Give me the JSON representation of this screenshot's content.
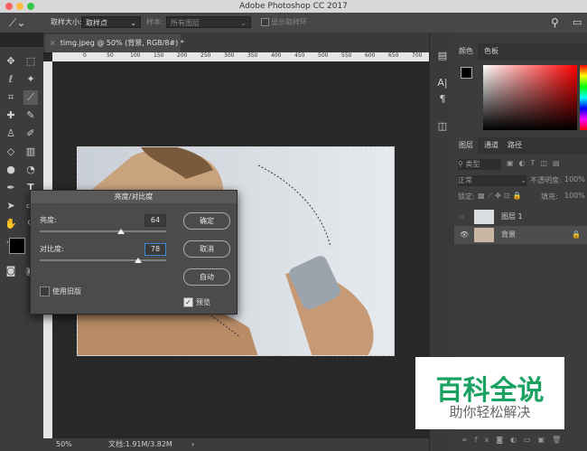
{
  "app": {
    "title": "Adobe Photoshop CC 2017"
  },
  "options": {
    "sample_size_label": "取样大小:",
    "sample_size_value": "取样点",
    "sample_label": "样本:",
    "sample_value": "所有图层",
    "show_ring_label": "显示取样环"
  },
  "document": {
    "tab_title": "timg.jpeg @ 50% (背景, RGB/8#) *",
    "zoom": "50%",
    "doc_info": "文档:1.91M/3.82M"
  },
  "ruler": {
    "ticks": [
      "0",
      "50",
      "100",
      "150",
      "200",
      "250",
      "300",
      "350",
      "400",
      "450",
      "500",
      "550",
      "600",
      "650",
      "700"
    ]
  },
  "panels": {
    "color_tab": "颜色",
    "swatches_tab": "色板",
    "layers_tab": "图层",
    "channels_tab": "通道",
    "paths_tab": "路径",
    "kind_filter": "类型",
    "blend_mode": "正常",
    "opacity_label": "不透明度:",
    "opacity_value": "100%",
    "lock_label": "锁定:",
    "fill_label": "填充:",
    "fill_value": "100%"
  },
  "layers": [
    {
      "name": "图层 1"
    },
    {
      "name": "背景"
    }
  ],
  "dialog": {
    "title": "亮度/对比度",
    "brightness_label": "亮度:",
    "brightness_value": "64",
    "contrast_label": "对比度:",
    "contrast_value": "78",
    "ok": "确定",
    "cancel": "取消",
    "auto": "自动",
    "use_legacy": "使用旧版",
    "preview": "预览",
    "brightness_level": 0.64,
    "contrast_level": 0.78
  },
  "watermark": {
    "main": "百科全说",
    "sub": "助你轻松解决"
  },
  "colors": {
    "fg": "#000000",
    "bg": "#ffffff",
    "accent": "#3b8ad8",
    "watermark_green": "#1aa260"
  }
}
